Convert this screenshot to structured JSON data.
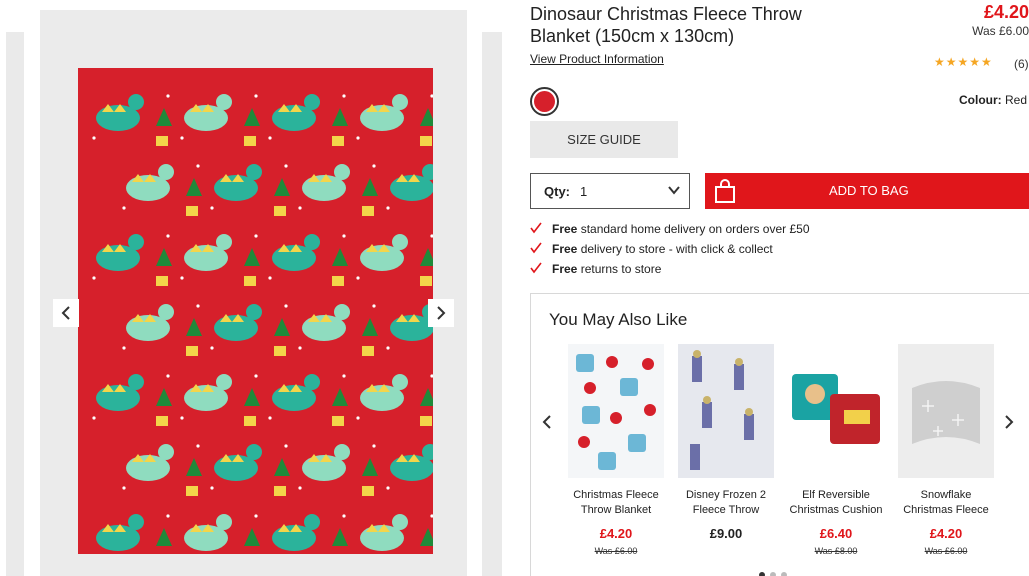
{
  "product": {
    "title": "Dinosaur Christmas Fleece Throw Blanket (150cm x 130cm)",
    "price": "£4.20",
    "was_price": "Was £6.00",
    "view_info": "View Product Information",
    "rating_stars": "★★★★★",
    "review_count": "(6)",
    "colour_label": "Colour:",
    "colour_value": "Red",
    "size_guide": "SIZE GUIDE",
    "qty_label": "Qty:",
    "qty_value": "1",
    "add_to_bag": "ADD TO BAG"
  },
  "benefits": [
    {
      "bold": "Free",
      "text": " standard home delivery on orders over £50"
    },
    {
      "bold": "Free",
      "text": " delivery to store - with click & collect"
    },
    {
      "bold": "Free",
      "text": " returns to store"
    }
  ],
  "recommendations": {
    "title": "You May Also Like",
    "items": [
      {
        "name": "Christmas Fleece Throw Blanket",
        "price": "£4.20",
        "was": "Was £6.00",
        "sale": true
      },
      {
        "name": "Disney Frozen 2 Fleece Throw",
        "price": "£9.00",
        "was": "",
        "sale": false
      },
      {
        "name": "Elf Reversible Christmas Cushion",
        "price": "£6.40",
        "was": "Was £8.00",
        "sale": true
      },
      {
        "name": "Snowflake Christmas Fleece",
        "price": "£4.20",
        "was": "Was £6.00",
        "sale": true
      }
    ]
  },
  "colors": {
    "brand_red": "#e0161b",
    "swatch_red": "#d6202b",
    "blanket_red": "#d6202b",
    "dino_mint": "#7fd6b4"
  },
  "icons": {
    "gallery_prev": "chevron-left-icon",
    "gallery_next": "chevron-right-icon",
    "bag": "shopping-bag-icon",
    "check": "check-icon",
    "dropdown": "chevron-down-icon"
  }
}
